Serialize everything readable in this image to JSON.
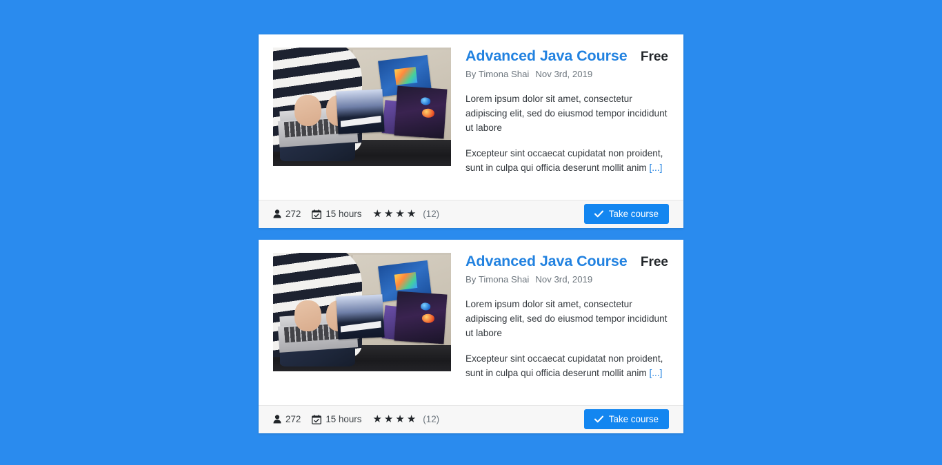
{
  "page": {
    "background_color": "#2a8bee",
    "accent_color": "#1386f0",
    "link_color": "#2282e0"
  },
  "cards": [
    {
      "title": "Advanced Java Course",
      "price": "Free",
      "author": "By Timona Shai",
      "date": "Nov 3rd, 2019",
      "paragraph_1": "Lorem ipsum dolor sit amet, consectetur adipiscing elit, sed do eiusmod tempor incididunt ut labore",
      "paragraph_2": "Excepteur sint occaecat cupidatat non proident, sunt in culpa qui officia deserunt mollit anim",
      "more_link": "[...]",
      "image_alt": "Person typing on a laptop on a couch next to programming books",
      "stats": {
        "students_icon": "user-icon",
        "students": "272",
        "duration_icon": "calendar-check-icon",
        "duration": "15 hours",
        "stars_filled": 4,
        "stars_total": 4,
        "rating_count": "(12)"
      },
      "action": {
        "icon": "check-icon",
        "label": "Take course"
      }
    },
    {
      "title": "Advanced Java Course",
      "price": "Free",
      "author": "By Timona Shai",
      "date": "Nov 3rd, 2019",
      "paragraph_1": "Lorem ipsum dolor sit amet, consectetur adipiscing elit, sed do eiusmod tempor incididunt ut labore",
      "paragraph_2": "Excepteur sint occaecat cupidatat non proident, sunt in culpa qui officia deserunt mollit anim",
      "more_link": "[...]",
      "image_alt": "Person typing on a laptop on a couch next to programming books",
      "stats": {
        "students_icon": "user-icon",
        "students": "272",
        "duration_icon": "calendar-check-icon",
        "duration": "15 hours",
        "stars_filled": 4,
        "stars_total": 4,
        "rating_count": "(12)"
      },
      "action": {
        "icon": "check-icon",
        "label": "Take course"
      }
    }
  ],
  "glyphs": {
    "star": "★"
  }
}
